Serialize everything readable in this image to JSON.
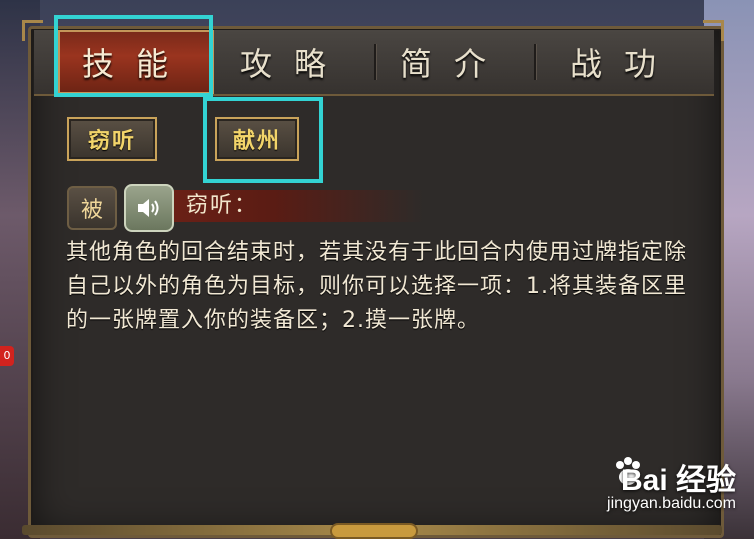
{
  "tabs": [
    {
      "label": "技能",
      "active": true
    },
    {
      "label": "攻略",
      "active": false
    },
    {
      "label": "简介",
      "active": false
    },
    {
      "label": "战功",
      "active": false
    }
  ],
  "skills": [
    {
      "label": "窃听"
    },
    {
      "label": "献州"
    }
  ],
  "skill_detail": {
    "type_badge": "被",
    "sound_icon": "speaker-icon",
    "name": "窃听：",
    "description": "其他角色的回合结束时，若其没有于此回合内使用过牌指定除自己以外的角色为目标，则你可以选择一项：1.将其装备区里的一张牌置入你的装备区；2.摸一张牌。"
  },
  "side_badge": "0",
  "watermark": {
    "brand": "Bai 经验",
    "url": "jingyan.baidu.com"
  },
  "colors": {
    "active_tab": "#9a341f",
    "highlight": "#33d3d3",
    "skill_text": "#f2d46a"
  }
}
